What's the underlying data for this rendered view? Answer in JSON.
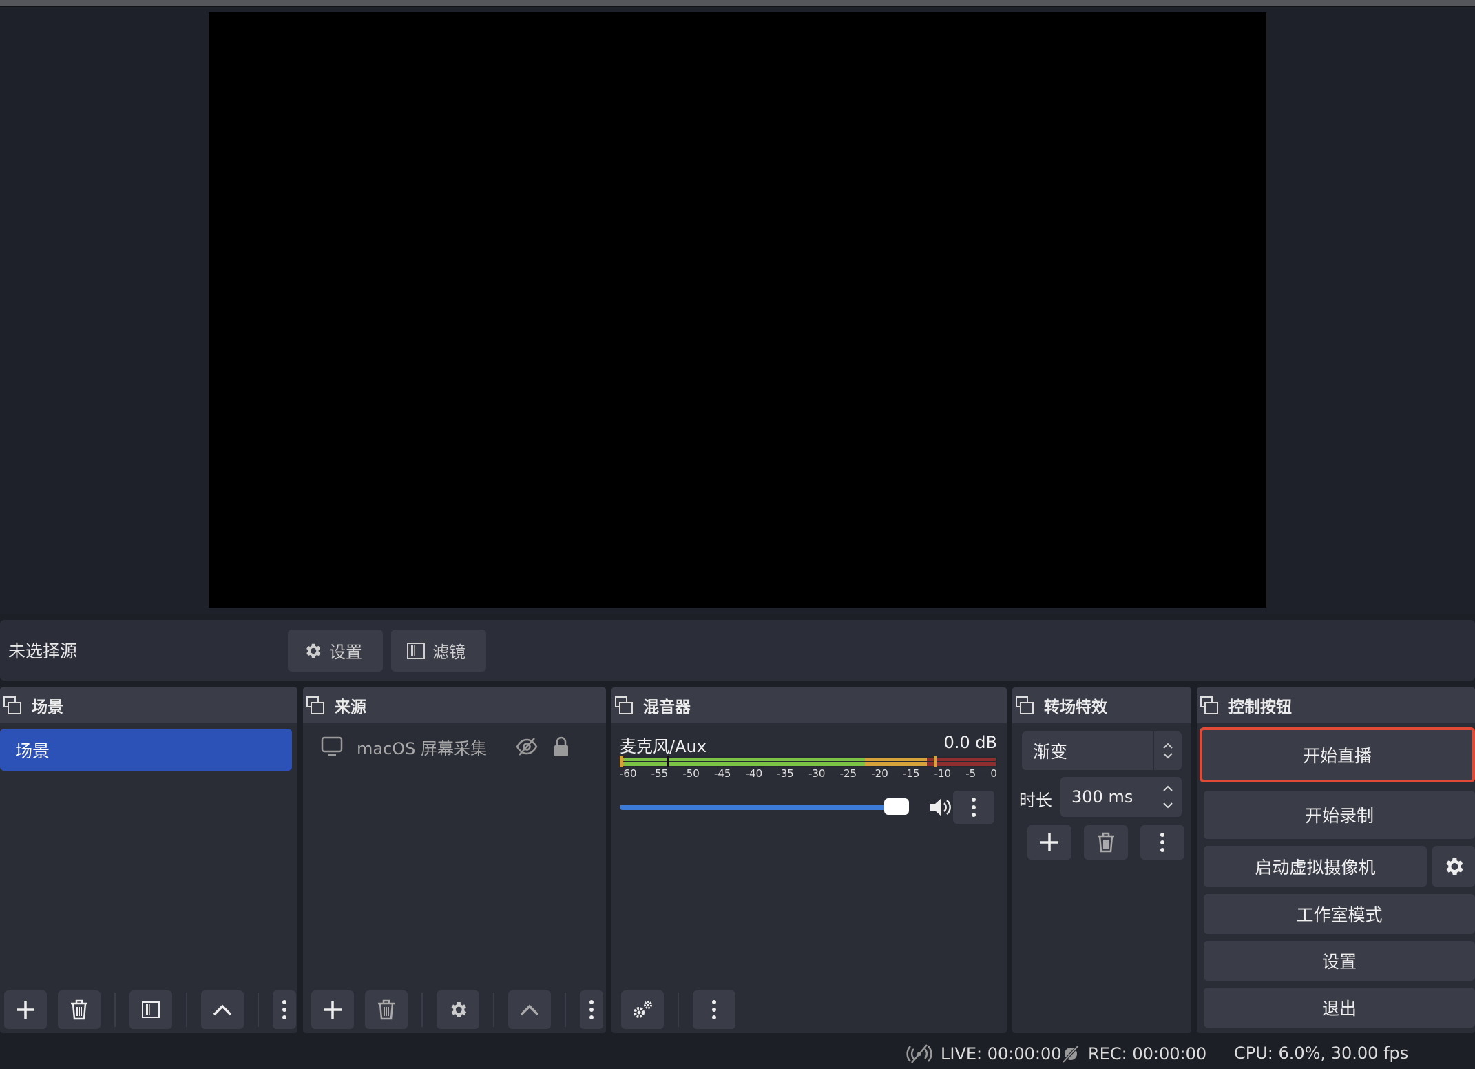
{
  "source_bar": {
    "no_source": "未选择源",
    "properties_label": "设置",
    "filters_label": "滤镜"
  },
  "scenes": {
    "title": "场景",
    "items": [
      "场景"
    ]
  },
  "sources": {
    "title": "来源",
    "items": [
      {
        "name": "macOS 屏幕采集"
      }
    ]
  },
  "mixer": {
    "title": "混音器",
    "channel_name": "麦克风/Aux",
    "channel_db": "0.0 dB",
    "ticks": [
      "-60",
      "-55",
      "-50",
      "-45",
      "-40",
      "-35",
      "-30",
      "-25",
      "-20",
      "-15",
      "-10",
      "-5",
      "0"
    ],
    "volume_level": 1.0
  },
  "transitions": {
    "title": "转场特效",
    "selected": "渐变",
    "duration_label": "时长",
    "duration_value": "300 ms"
  },
  "controls": {
    "title": "控制按钮",
    "start_stream": "开始直播",
    "start_record": "开始录制",
    "virtual_cam": "启动虚拟摄像机",
    "studio_mode": "工作室模式",
    "settings": "设置",
    "exit": "退出"
  },
  "status": {
    "live": "LIVE: 00:00:00",
    "rec": "REC: 00:00:00",
    "cpu": "CPU: 6.0%, 30.00 fps"
  },
  "colors": {
    "accent": "#2c52b8",
    "highlight_border": "#e04a36",
    "meter_green": "#7cc244",
    "meter_yellow": "#d6a33a",
    "meter_red": "#8f2e2e",
    "slider": "#3d7bd8"
  }
}
